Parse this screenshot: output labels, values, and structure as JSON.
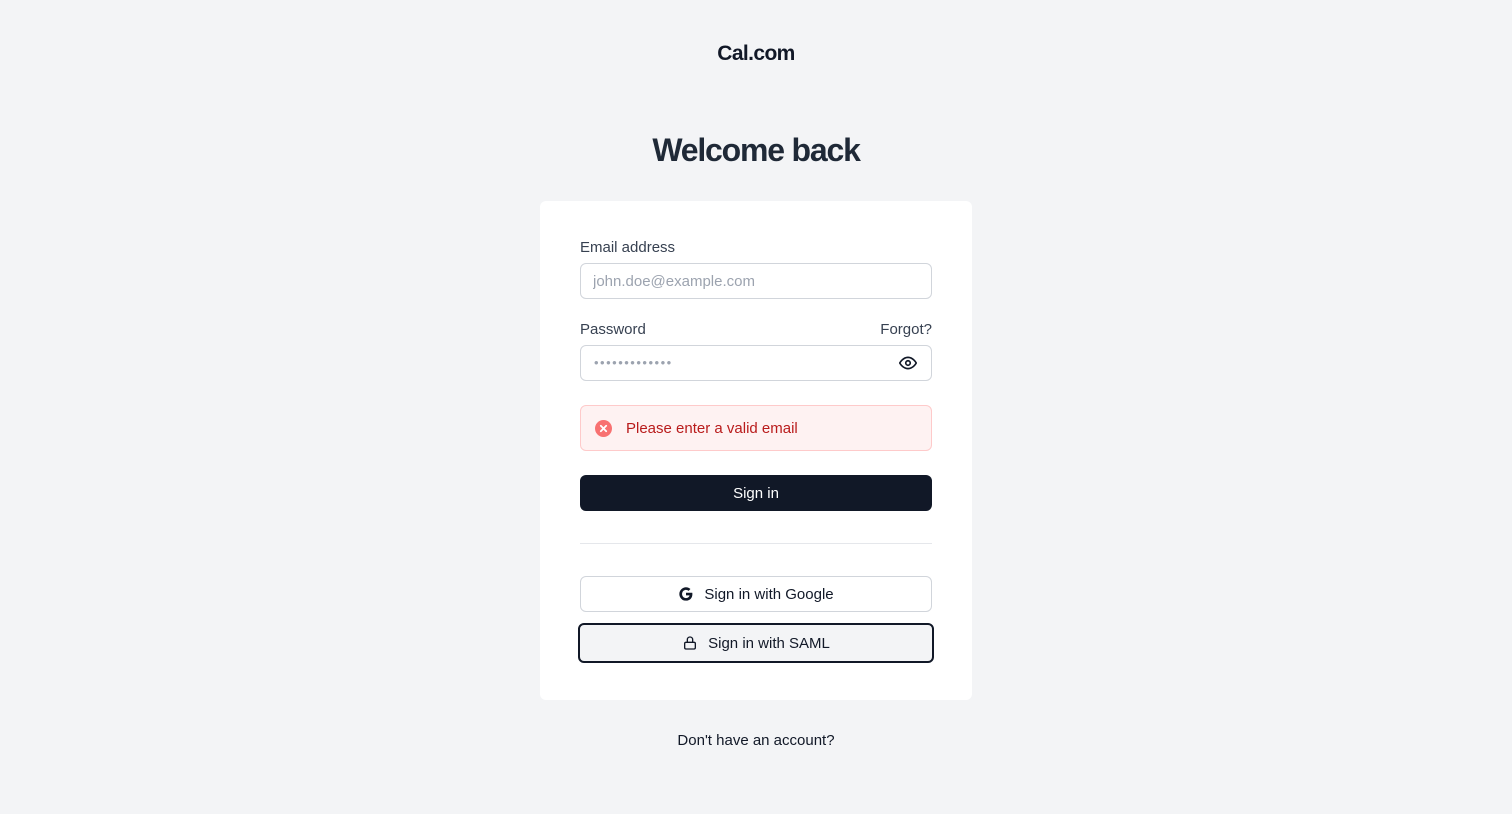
{
  "brand": {
    "logo": "Cal.com"
  },
  "heading": "Welcome back",
  "form": {
    "email": {
      "label": "Email address",
      "placeholder": "john.doe@example.com",
      "value": ""
    },
    "password": {
      "label": "Password",
      "masked_value": "•••••••••••••",
      "forgot_label": "Forgot?"
    },
    "error": {
      "message": "Please enter a valid email",
      "color": "#b91c1c"
    },
    "submit_label": "Sign in"
  },
  "sso": {
    "google_label": "Sign in with Google",
    "saml_label": "Sign in with SAML"
  },
  "footer": {
    "signup_label": "Don't have an account?"
  },
  "icons": {
    "eye": "eye-icon",
    "error": "x-circle-icon",
    "google": "google-icon",
    "lock": "lock-icon"
  },
  "colors": {
    "background": "#f3f4f6",
    "primary": "#111827",
    "error_bg": "#fef2f2"
  }
}
